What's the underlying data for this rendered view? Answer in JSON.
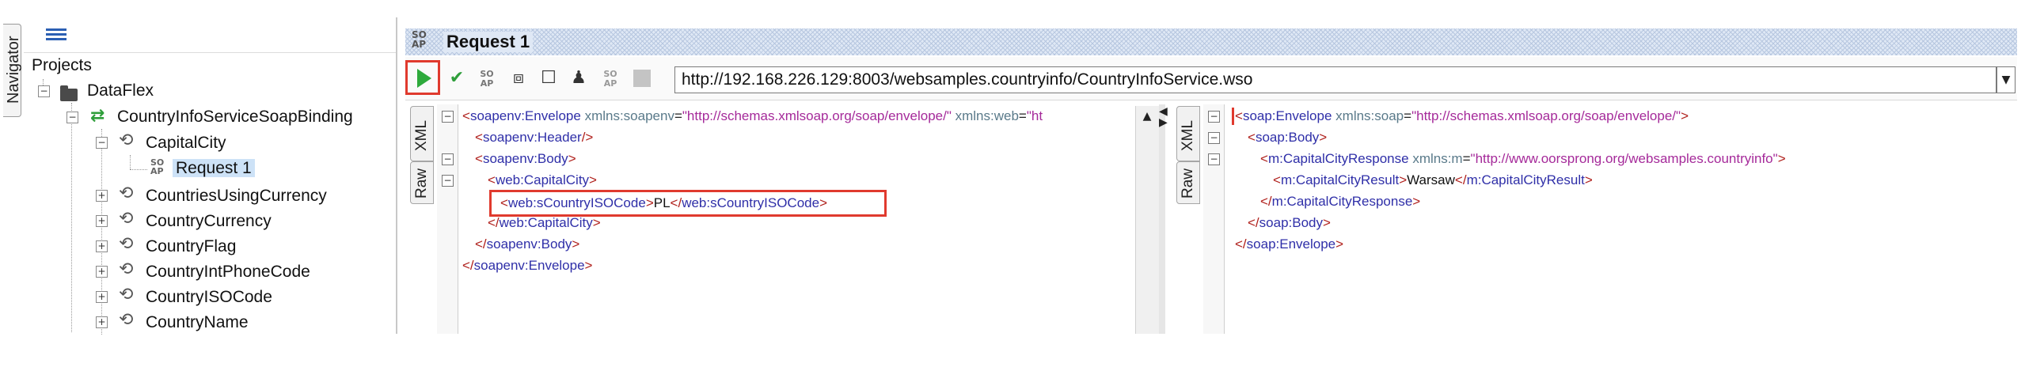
{
  "navigator": {
    "tab_label": "Navigator"
  },
  "tree": {
    "projects_label": "Projects",
    "project": "DataFlex",
    "binding": "CountryInfoServiceSoapBinding",
    "operations": [
      {
        "name": "CapitalCity",
        "expanded": true
      },
      {
        "name": "CountriesUsingCurrency",
        "expanded": false
      },
      {
        "name": "CountryCurrency",
        "expanded": false
      },
      {
        "name": "CountryFlag",
        "expanded": false
      },
      {
        "name": "CountryIntPhoneCode",
        "expanded": false
      },
      {
        "name": "CountryISOCode",
        "expanded": false
      },
      {
        "name": "CountryName",
        "expanded": false
      }
    ],
    "request": "Request 1",
    "soap_icon": "SO AP"
  },
  "request_panel": {
    "title": "Request 1",
    "soap_icon": "SO AP",
    "url": "http://192.168.226.129:8003/websamples.countryinfo/CountryInfoService.wso",
    "toolbar_icons": [
      "run-icon",
      "validate-icon",
      "soap-icon",
      "format-icon",
      "checkbox-icon",
      "stamp-icon",
      "soap-icon-2",
      "gray-square-icon"
    ]
  },
  "editor_tabs": {
    "xml": "XML",
    "raw": "Raw"
  },
  "request_xml": {
    "line1_tag": "soapenv:Envelope",
    "line1_attr1": "xmlns:soapenv",
    "line1_val1": "\"http://schemas.xmlsoap.org/soap/envelope/\"",
    "line1_attr2": "xmlns:web",
    "line1_val2": "\"ht",
    "line2_tag": "soapenv:Header",
    "line3_tag": "soapenv:Body",
    "line4_tag": "web:CapitalCity",
    "line5_tag": "web:sCountryISOCode",
    "line5_text": "PL",
    "line5_close": "web:sCountryISOCode",
    "line6_close": "web:CapitalCity",
    "line7_close": "soapenv:Body",
    "line8_close": "soapenv:Envelope"
  },
  "response_xml": {
    "line1_tag": "soap:Envelope",
    "line1_attr": "xmlns:soap",
    "line1_val": "\"http://schemas.xmlsoap.org/soap/envelope/\"",
    "line2_tag": "soap:Body",
    "line3_tag": "m:CapitalCityResponse",
    "line3_attr": "xmlns:m",
    "line3_val": "\"http://www.oorsprong.org/websamples.countryinfo\"",
    "line4_tag": "m:CapitalCityResult",
    "line4_text": "Warsaw",
    "line4_close": "m:CapitalCityResult",
    "line5_close": "m:CapitalCityResponse",
    "line6_close": "soap:Body",
    "line7_close": "soap:Envelope"
  },
  "colors": {
    "highlight": "#e03a2e",
    "run_green": "#2eaa3c",
    "tag_blue": "#2f2fa8",
    "bracket_red": "#b0201c",
    "value_purple": "#a52a9a"
  }
}
